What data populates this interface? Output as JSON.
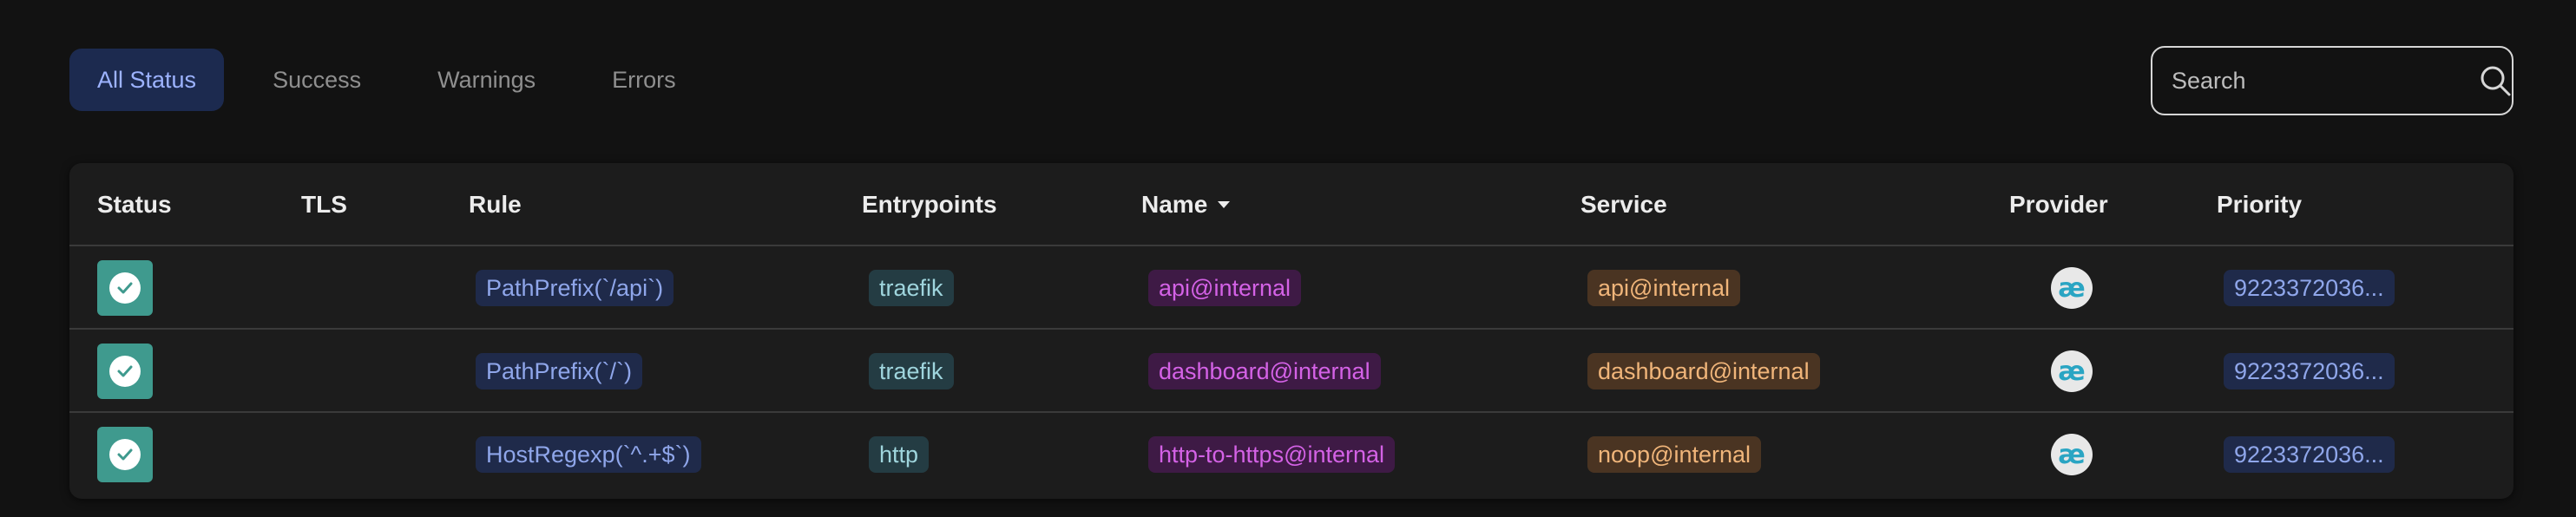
{
  "filters": {
    "tabs": [
      {
        "label": "All Status",
        "active": true
      },
      {
        "label": "Success",
        "active": false
      },
      {
        "label": "Warnings",
        "active": false
      },
      {
        "label": "Errors",
        "active": false
      }
    ]
  },
  "search": {
    "placeholder": "Search",
    "icon": "search-icon"
  },
  "table": {
    "columns": [
      "Status",
      "TLS",
      "Rule",
      "Entrypoints",
      "Name",
      "Service",
      "Provider",
      "Priority"
    ],
    "sorted_column": "Name",
    "sort_direction": "descending",
    "rows": [
      {
        "status": "success",
        "tls": "",
        "rule": "PathPrefix(`/api`)",
        "entrypoints": "traefik",
        "name": "api@internal",
        "service": "api@internal",
        "provider": "æ",
        "priority": "9223372036..."
      },
      {
        "status": "success",
        "tls": "",
        "rule": "PathPrefix(`/`)",
        "entrypoints": "traefik",
        "name": "dashboard@internal",
        "service": "dashboard@internal",
        "provider": "æ",
        "priority": "9223372036..."
      },
      {
        "status": "success",
        "tls": "",
        "rule": "HostRegexp(`^.+$`)",
        "entrypoints": "http",
        "name": "http-to-https@internal",
        "service": "noop@internal",
        "provider": "æ",
        "priority": "9223372036..."
      }
    ]
  },
  "colors": {
    "background": "#121212",
    "active_tab": "#1c2a4f",
    "status_success": "#3f9a8e",
    "rule_badge": "#1f2a4a",
    "entrypoint_badge": "#243c43",
    "name_badge": "#3e1a45",
    "service_badge": "#4a3422"
  }
}
